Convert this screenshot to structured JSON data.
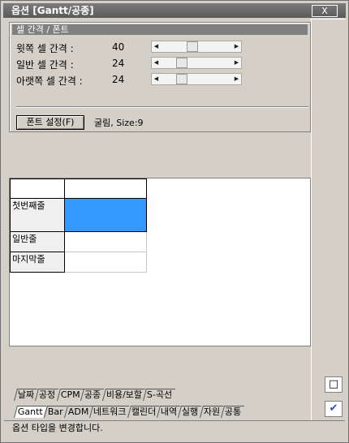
{
  "window": {
    "title": "옵션 [Gantt/공종]",
    "close_label": "X"
  },
  "group": {
    "title": "셀 간격 / 폰트"
  },
  "spacing": [
    {
      "label": "윗쪽 셀 간격 :",
      "value": "40",
      "level": 0.42
    },
    {
      "label": "일반 셀 간격 :",
      "value": "24",
      "level": 0.26
    },
    {
      "label": "아랫쪽 셀 간격 :",
      "value": "24",
      "level": 0.26
    }
  ],
  "font": {
    "button_label": "폰트 설정(F)",
    "info": "굴림, Size:9"
  },
  "preview": {
    "rows": [
      "첫번째줄",
      "일반줄",
      "마지막줄"
    ]
  },
  "tabs_row1": [
    "날짜",
    "공정",
    "CPM",
    "공종",
    "비용/보할",
    "S-곡선"
  ],
  "tabs_row2": [
    "Gantt",
    "Bar",
    "ADM",
    "네트워크",
    "캘린더",
    "내역",
    "실행",
    "자원",
    "공통"
  ],
  "status": "옵션 타입을 변경합니다.",
  "icons": {
    "note": "note-icon",
    "apply": "checkmark-icon"
  },
  "colors": {
    "title_bg": "#6a6a6a",
    "highlight": "#3399ff"
  }
}
